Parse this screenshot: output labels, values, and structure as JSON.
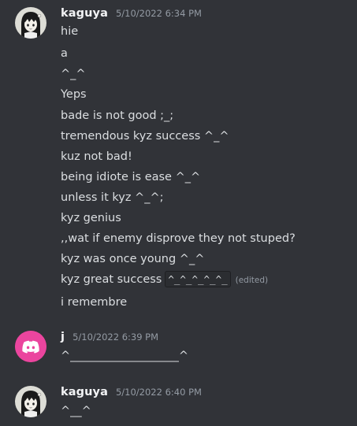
{
  "colors": {
    "background": "#313338",
    "text": "#dbdee1",
    "username": "#f2f3f5",
    "timestamp": "#949ba4",
    "discord_brand": "#eb459e"
  },
  "messages": [
    {
      "author": "kaguya",
      "timestamp": "5/10/2022 6:34 PM",
      "avatar_icon": "anime-girl-avatar",
      "lines": [
        "hie",
        "a",
        "^_^",
        "Yeps",
        "bade is not good ;_;",
        "tremendous kyz success ^_^",
        "kuz not bad!",
        "being idiote is ease ^_^",
        "unless it kyz ^_^;",
        "kyz genius",
        ",,wat if enemy disprove they not stuped?",
        "kyz was once young ^_^",
        "kyz great success",
        "i remembre"
      ],
      "inline_code": "^_^_^_^_^_",
      "edited_label": "(edited)"
    },
    {
      "author": "j",
      "timestamp": "5/10/2022 6:39 PM",
      "avatar_icon": "discord-logo-icon",
      "lines": [
        "^___________________^"
      ]
    },
    {
      "author": "kaguya",
      "timestamp": "5/10/2022 6:40 PM",
      "avatar_icon": "anime-girl-avatar",
      "lines": [
        "^__^"
      ]
    }
  ]
}
